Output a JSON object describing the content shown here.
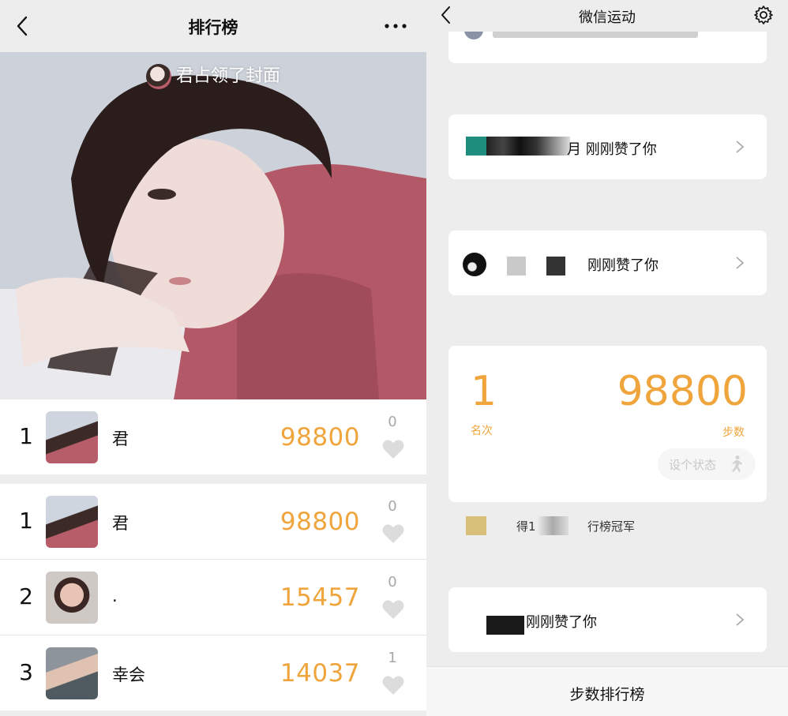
{
  "left": {
    "nav": {
      "title": "排行榜"
    },
    "cover": {
      "caption": "君占领了封面"
    },
    "my_row": {
      "rank": "1",
      "name": "君",
      "steps": "98800",
      "likes": "0"
    },
    "list": [
      {
        "rank": "1",
        "name": "君",
        "steps": "98800",
        "likes": "0"
      },
      {
        "rank": "2",
        "name": ".",
        "steps": "15457",
        "likes": "0"
      },
      {
        "rank": "3",
        "name": "幸会",
        "steps": "14037",
        "likes": "1"
      }
    ]
  },
  "right": {
    "nav": {
      "title": "微信运动"
    },
    "like_cards": [
      {
        "text": "月 刚刚赞了你"
      },
      {
        "text": "刚刚赞了你"
      },
      {
        "text": "刚刚赞了你"
      }
    ],
    "stats": {
      "rank_value": "1",
      "rank_label": "名次",
      "steps_value": "98800",
      "steps_label": "步数",
      "status_button": "设个状态"
    },
    "champion": {
      "part1": "得1",
      "part2": "行榜冠军"
    },
    "bottom_bar": {
      "label": "步数排行榜"
    }
  },
  "colors": {
    "accent": "#f0a43c",
    "background": "#ededed",
    "card": "#ffffff"
  },
  "icons": [
    "back-arrow-icon",
    "more-dots-icon",
    "heart-icon",
    "chevron-right-icon",
    "gear-icon",
    "runner-icon"
  ]
}
